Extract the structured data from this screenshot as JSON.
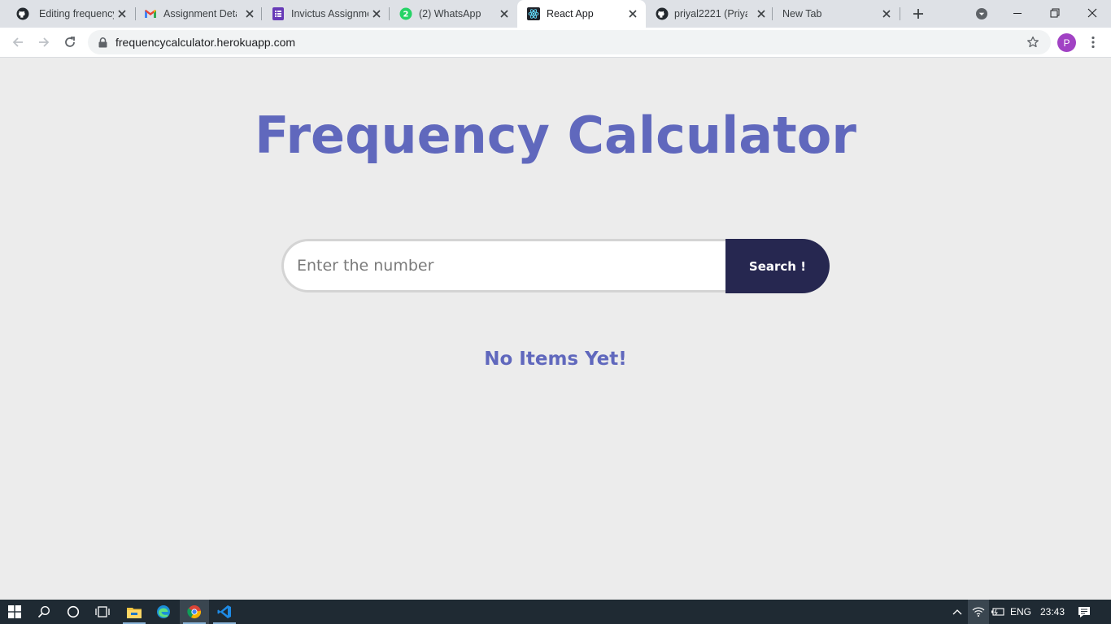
{
  "browser": {
    "tabs": [
      {
        "title": "Editing frequency",
        "icon": "github-icon"
      },
      {
        "title": "Assignment Deta",
        "icon": "gmail-icon"
      },
      {
        "title": "Invictus Assignme",
        "icon": "forms-icon"
      },
      {
        "title": "(2) WhatsApp",
        "icon": "whatsapp-icon",
        "badge": "2"
      },
      {
        "title": "React App",
        "icon": "react-icon",
        "active": true
      },
      {
        "title": "priyal2221 (Priyal",
        "icon": "github-icon"
      },
      {
        "title": "New Tab",
        "icon": "none"
      }
    ],
    "url": "frequencycalculator.herokuapp.com",
    "profile_initial": "P"
  },
  "page": {
    "title": "Frequency Calculator",
    "search": {
      "placeholder": "Enter the number",
      "value": "",
      "button_label": "Search !"
    },
    "empty_message": "No Items Yet!"
  },
  "taskbar": {
    "language": "ENG",
    "time": "23:43"
  },
  "colors": {
    "accent": "#6068bd",
    "button_bg": "#262750",
    "page_bg": "#ececec"
  }
}
